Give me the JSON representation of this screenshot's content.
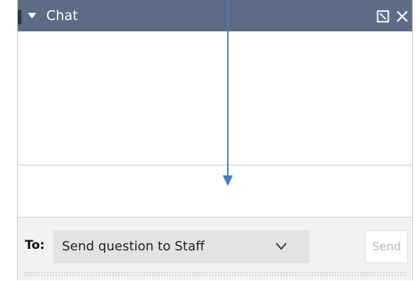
{
  "chat_panel": {
    "title": "Chat",
    "icons": {
      "collapse": "caret-down-icon",
      "popout": "popout-icon",
      "close": "close-icon"
    },
    "messages": [],
    "compose_text": "",
    "footer": {
      "to_label": "To:",
      "recipient_selected": "Send question to Staff",
      "send_label": "Send",
      "send_enabled": false
    }
  },
  "annotation": {
    "type": "arrow",
    "color": "#3f7fc4"
  },
  "colors": {
    "header_bg": "#5e6b85",
    "header_text": "#ffffff",
    "select_bg": "#e3e3e3",
    "send_disabled_text": "#b9b9b9"
  }
}
